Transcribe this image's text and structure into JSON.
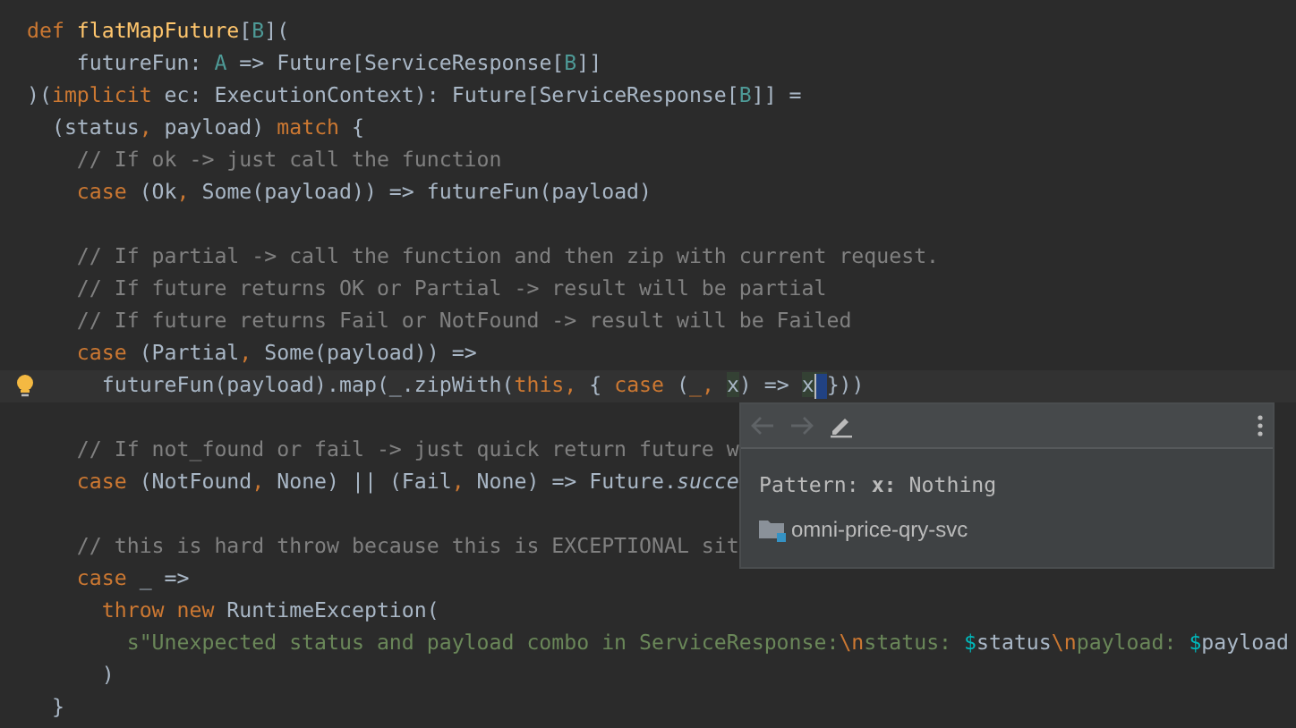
{
  "editor": {
    "lines": [
      {
        "kind": "code",
        "tokens": [
          {
            "t": "def ",
            "kind": "kw"
          },
          {
            "t": "flatMapFuture",
            "kind": "fn"
          },
          {
            "t": "[",
            "kind": "plain"
          },
          {
            "t": "B",
            "kind": "tp"
          },
          {
            "t": "](",
            "kind": "plain"
          }
        ]
      },
      {
        "kind": "code",
        "tokens": [
          {
            "t": "    futureFun: ",
            "kind": "plain"
          },
          {
            "t": "A",
            "kind": "tp"
          },
          {
            "t": " => Future[ServiceResponse[",
            "kind": "plain"
          },
          {
            "t": "B",
            "kind": "tp"
          },
          {
            "t": "]]",
            "kind": "plain"
          }
        ]
      },
      {
        "kind": "code",
        "tokens": [
          {
            "t": ")(",
            "kind": "plain"
          },
          {
            "t": "implicit",
            "kind": "kw"
          },
          {
            "t": " ec: ExecutionContext): Future[ServiceResponse[",
            "kind": "plain"
          },
          {
            "t": "B",
            "kind": "tp"
          },
          {
            "t": "]] =",
            "kind": "plain"
          }
        ]
      },
      {
        "kind": "code",
        "tokens": [
          {
            "t": "  (status",
            "kind": "plain"
          },
          {
            "t": ",",
            "kind": "kw"
          },
          {
            "t": " payload) ",
            "kind": "plain"
          },
          {
            "t": "match",
            "kind": "kw"
          },
          {
            "t": " {",
            "kind": "plain"
          }
        ]
      },
      {
        "kind": "code",
        "tokens": [
          {
            "t": "    // If ok -> just call the function",
            "kind": "comment"
          }
        ]
      },
      {
        "kind": "code",
        "tokens": [
          {
            "t": "    case",
            "kind": "kw"
          },
          {
            "t": " (Ok",
            "kind": "plain"
          },
          {
            "t": ",",
            "kind": "kw"
          },
          {
            "t": " Some(payload)) => futureFun(payload)",
            "kind": "plain"
          }
        ]
      },
      {
        "kind": "blank"
      },
      {
        "kind": "code",
        "tokens": [
          {
            "t": "    // If partial -> call the function and then zip with current request.",
            "kind": "comment"
          }
        ]
      },
      {
        "kind": "code",
        "tokens": [
          {
            "t": "    // If future returns OK or Partial -> result will be partial",
            "kind": "comment"
          }
        ]
      },
      {
        "kind": "code",
        "tokens": [
          {
            "t": "    // If future returns Fail or NotFound -> result will be Failed",
            "kind": "comment"
          }
        ]
      },
      {
        "kind": "code",
        "tokens": [
          {
            "t": "    case",
            "kind": "kw"
          },
          {
            "t": " (Partial",
            "kind": "plain"
          },
          {
            "t": ",",
            "kind": "kw"
          },
          {
            "t": " Some(payload)) =>",
            "kind": "plain"
          }
        ]
      },
      {
        "kind": "code",
        "current": true,
        "bulb": true,
        "tokens": [
          {
            "t": "      futureFun(payload).map(_.zipWith(",
            "kind": "plain"
          },
          {
            "t": "this",
            "kind": "kw"
          },
          {
            "t": ",",
            "kind": "kw"
          },
          {
            "t": " { ",
            "kind": "plain"
          },
          {
            "t": "case",
            "kind": "kw"
          },
          {
            "t": " (",
            "kind": "plain"
          },
          {
            "t": "_",
            "kind": "kw"
          },
          {
            "t": ", ",
            "kind": "kw"
          },
          {
            "t": "x",
            "kind": "usage"
          },
          {
            "t": ") => ",
            "kind": "plain"
          },
          {
            "t": "x",
            "kind": "usage",
            "caret_after": true
          },
          {
            "t": "}))",
            "kind": "plain"
          }
        ]
      },
      {
        "kind": "blank"
      },
      {
        "kind": "code",
        "tokens": [
          {
            "t": "    // If not_found or fail -> just quick return future w",
            "kind": "comment"
          }
        ]
      },
      {
        "kind": "code",
        "tokens": [
          {
            "t": "    case",
            "kind": "kw"
          },
          {
            "t": " (NotFound",
            "kind": "plain"
          },
          {
            "t": ",",
            "kind": "kw"
          },
          {
            "t": " None) || (Fail",
            "kind": "plain"
          },
          {
            "t": ",",
            "kind": "kw"
          },
          {
            "t": " None) => Future.",
            "kind": "plain"
          },
          {
            "t": "succe",
            "kind": "italic"
          }
        ]
      },
      {
        "kind": "blank"
      },
      {
        "kind": "code",
        "tokens": [
          {
            "t": "    // this is hard throw because this is EXCEPTIONAL sit",
            "kind": "comment"
          }
        ]
      },
      {
        "kind": "code",
        "tokens": [
          {
            "t": "    case",
            "kind": "kw"
          },
          {
            "t": " _ =>",
            "kind": "plain"
          }
        ]
      },
      {
        "kind": "code",
        "tokens": [
          {
            "t": "      throw new",
            "kind": "kw"
          },
          {
            "t": " RuntimeException(",
            "kind": "plain"
          }
        ]
      },
      {
        "kind": "code",
        "tokens": [
          {
            "t": "        s\"Unexpected status and payload combo in ServiceResponse:",
            "kind": "str"
          },
          {
            "t": "\\n",
            "kind": "esc"
          },
          {
            "t": "status: ",
            "kind": "str"
          },
          {
            "t": "$",
            "kind": "interp"
          },
          {
            "t": "status",
            "kind": "plain"
          },
          {
            "t": "\\n",
            "kind": "esc"
          },
          {
            "t": "payload: ",
            "kind": "str"
          },
          {
            "t": "$",
            "kind": "interp"
          },
          {
            "t": "payload",
            "kind": "plain"
          }
        ]
      },
      {
        "kind": "code",
        "tokens": [
          {
            "t": "      )",
            "kind": "plain"
          }
        ]
      },
      {
        "kind": "code",
        "tokens": [
          {
            "t": "  }",
            "kind": "plain"
          }
        ]
      }
    ]
  },
  "popup": {
    "back_disabled": true,
    "forward_disabled": true,
    "signature": "Pattern: **x:** Nothing",
    "module": "omni-price-qry-svc"
  }
}
